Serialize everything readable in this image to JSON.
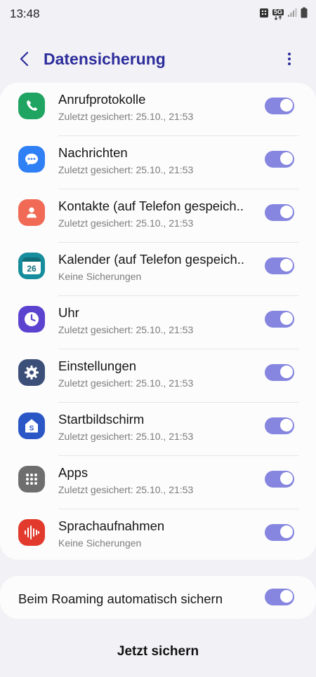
{
  "status_bar": {
    "time": "13:48",
    "network_label": "5G"
  },
  "app_bar": {
    "title": "Datensicherung",
    "back_icon": "back-arrow-icon",
    "more_icon": "more-vertical-icon"
  },
  "items": [
    {
      "title": "Anrufprotokolle",
      "subtitle": "Zuletzt gesichert: 25.10., 21:53",
      "icon": "phone-icon",
      "color": "#1fa461",
      "enabled": true
    },
    {
      "title": "Nachrichten",
      "subtitle": "Zuletzt gesichert: 25.10., 21:53",
      "icon": "message-icon",
      "color": "#2f7ff5",
      "enabled": true
    },
    {
      "title": "Kontakte (auf Telefon gespeich..",
      "subtitle": "Zuletzt gesichert: 25.10., 21:53",
      "icon": "contact-icon",
      "color": "#f06a55",
      "enabled": true
    },
    {
      "title": "Kalender (auf Telefon gespeich..",
      "subtitle": "Keine Sicherungen",
      "icon": "calendar-icon",
      "calendar_day": "26",
      "color": "#168d9c",
      "enabled": true
    },
    {
      "title": "Uhr",
      "subtitle": "Zuletzt gesichert: 25.10., 21:53",
      "icon": "clock-icon",
      "color": "#5b43cf",
      "enabled": true
    },
    {
      "title": "Einstellungen",
      "subtitle": "Zuletzt gesichert: 25.10., 21:53",
      "icon": "gear-icon",
      "color": "#3c4f79",
      "enabled": true
    },
    {
      "title": "Startbildschirm",
      "subtitle": "Zuletzt gesichert: 25.10., 21:53",
      "icon": "home-icon",
      "color": "#2a56c6",
      "enabled": true
    },
    {
      "title": "Apps",
      "subtitle": "Zuletzt gesichert: 25.10., 21:53",
      "icon": "apps-grid-icon",
      "color": "#6e6e6e",
      "enabled": true
    },
    {
      "title": "Sprachaufnahmen",
      "subtitle": "Keine Sicherungen",
      "icon": "voice-recorder-icon",
      "color": "#e23a2c",
      "enabled": true
    }
  ],
  "roaming": {
    "label": "Beim Roaming automatisch sichern",
    "enabled": true
  },
  "backup_now_label": "Jetzt sichern",
  "colors": {
    "accent": "#2d2d9c",
    "toggle_on": "#8686e0",
    "background": "#f2f2f6"
  }
}
